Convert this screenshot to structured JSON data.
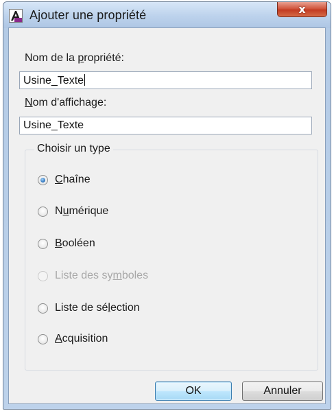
{
  "window": {
    "title": "Ajouter une propriété",
    "close_glyph": "x",
    "app_icon": "autocad-app-icon"
  },
  "form": {
    "property_name": {
      "label_before": "Nom de la ",
      "label_mnemonic": "p",
      "label_after": "ropriété:",
      "value": "Usine_Texte"
    },
    "display_name": {
      "label_mnemonic": "N",
      "label_after": "om d'affichage:",
      "value": "Usine_Texte"
    }
  },
  "type_group": {
    "legend": "Choisir un type",
    "options": [
      {
        "before": "",
        "mnemonic": "C",
        "after": "haîne",
        "checked": true,
        "enabled": true
      },
      {
        "before": "N",
        "mnemonic": "u",
        "after": "mérique",
        "checked": false,
        "enabled": true
      },
      {
        "before": "",
        "mnemonic": "B",
        "after": "ooléen",
        "checked": false,
        "enabled": true
      },
      {
        "before": "Liste des sy",
        "mnemonic": "m",
        "after": "boles",
        "checked": false,
        "enabled": false
      },
      {
        "before": "Liste de sé",
        "mnemonic": "l",
        "after": "ection",
        "checked": false,
        "enabled": true
      },
      {
        "before": "",
        "mnemonic": "A",
        "after": "cquisition",
        "checked": false,
        "enabled": true
      }
    ]
  },
  "buttons": {
    "ok": "OK",
    "cancel": "Annuler"
  },
  "colors": {
    "accent": "#3c7fb1",
    "close": "#c23b22",
    "disabled_text": "#a8a8a8"
  }
}
